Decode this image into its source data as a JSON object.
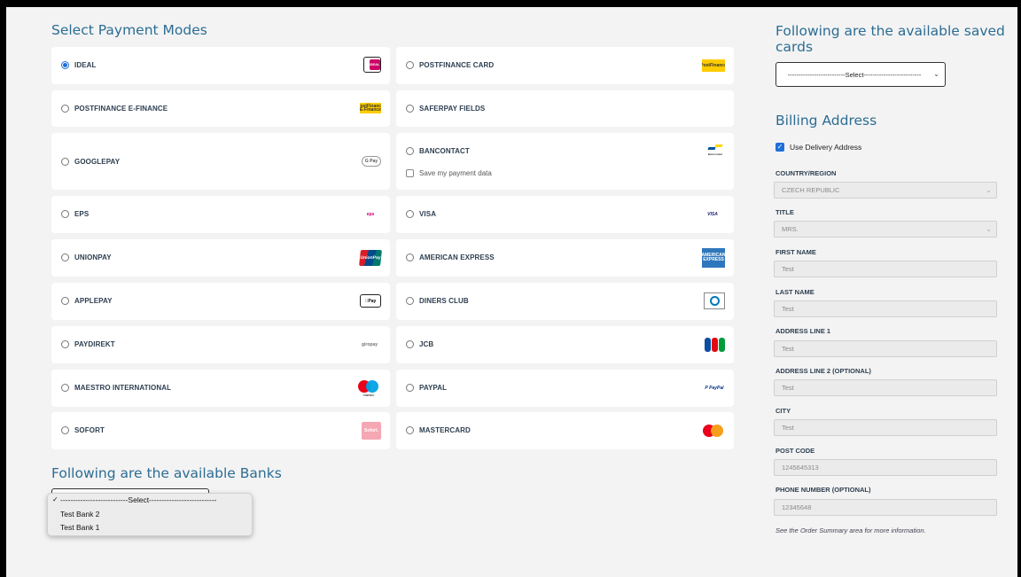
{
  "payment_modes": {
    "title": "Select Payment Modes",
    "save_payment_label": "Save my payment data",
    "items": {
      "ideal": {
        "label": "IDEAL",
        "selected": true,
        "logo_text": "iDEAL"
      },
      "postfinance_card": {
        "label": "POSTFINANCE CARD",
        "selected": false,
        "logo_text": "PostFinance"
      },
      "postfinance_efinance": {
        "label": "POSTFINANCE E-FINANCE",
        "selected": false,
        "logo_text": "PostFinance E-Finance"
      },
      "saferpay_fields": {
        "label": "SAFERPAY FIELDS",
        "selected": false
      },
      "googlepay": {
        "label": "GOOGLEPAY",
        "selected": false,
        "logo_text": "G Pay"
      },
      "bancontact": {
        "label": "BANCONTACT",
        "selected": false,
        "logo_text": "Bancontact"
      },
      "eps": {
        "label": "EPS",
        "selected": false,
        "logo_text": "eps"
      },
      "visa": {
        "label": "VISA",
        "selected": false,
        "logo_text": "VISA"
      },
      "unionpay": {
        "label": "UNIONPAY",
        "selected": false,
        "logo_text": "UnionPay"
      },
      "amex": {
        "label": "AMERICAN EXPRESS",
        "selected": false,
        "logo_text": "AMERICAN EXPRESS"
      },
      "applepay": {
        "label": "APPLEPAY",
        "selected": false,
        "logo_text": "Pay"
      },
      "diners": {
        "label": "DINERS CLUB",
        "selected": false,
        "logo_text": "Diners Club"
      },
      "paydirekt": {
        "label": "PAYDIREKT",
        "selected": false,
        "logo_text": "giropay"
      },
      "jcb": {
        "label": "JCB",
        "selected": false,
        "logo_text": "JCB"
      },
      "maestro": {
        "label": "MAESTRO INTERNATIONAL",
        "selected": false,
        "logo_text": "maestro"
      },
      "paypal": {
        "label": "PAYPAL",
        "selected": false,
        "logo_text": "PayPal"
      },
      "sofort": {
        "label": "SOFORT",
        "selected": false,
        "logo_text": "Sofort."
      },
      "mastercard": {
        "label": "MASTERCARD",
        "selected": false
      }
    }
  },
  "banks": {
    "title": "Following are the available Banks",
    "options": [
      "---------------------------Select---------------------------",
      "Test Bank 2",
      "Test Bank 1"
    ],
    "selected_mark": "✓"
  },
  "saved_cards": {
    "title": "Following are the available saved cards",
    "selected": "--------------------------Select--------------------------"
  },
  "billing": {
    "title": "Billing Address",
    "use_delivery_label": "Use Delivery Address",
    "use_delivery_checked": true,
    "fields": {
      "country": {
        "label": "COUNTRY/REGION",
        "value": "CZECH REPUBLIC"
      },
      "title": {
        "label": "TITLE",
        "value": "MRS."
      },
      "first_name": {
        "label": "FIRST NAME",
        "value": "Test"
      },
      "last_name": {
        "label": "LAST NAME",
        "value": "Test"
      },
      "address1": {
        "label": "ADDRESS LINE 1",
        "value": "Test"
      },
      "address2": {
        "label": "ADDRESS LINE 2 (OPTIONAL)",
        "value": "Test"
      },
      "city": {
        "label": "CITY",
        "value": "Test"
      },
      "post_code": {
        "label": "POST CODE",
        "value": "1245645313"
      },
      "phone": {
        "label": "PHONE NUMBER (OPTIONAL)",
        "value": "12345648"
      }
    },
    "info_note": "See the Order Summary area for more information."
  },
  "colors": {
    "heading": "#2c6d94",
    "label": "#2d3e50",
    "accent": "#1e6fd9",
    "page_bg": "#f3f3f3",
    "card_bg": "#ffffff"
  },
  "icons": [
    "radio-button",
    "checkbox",
    "chevron-down-icon",
    "checkmark-icon"
  ]
}
